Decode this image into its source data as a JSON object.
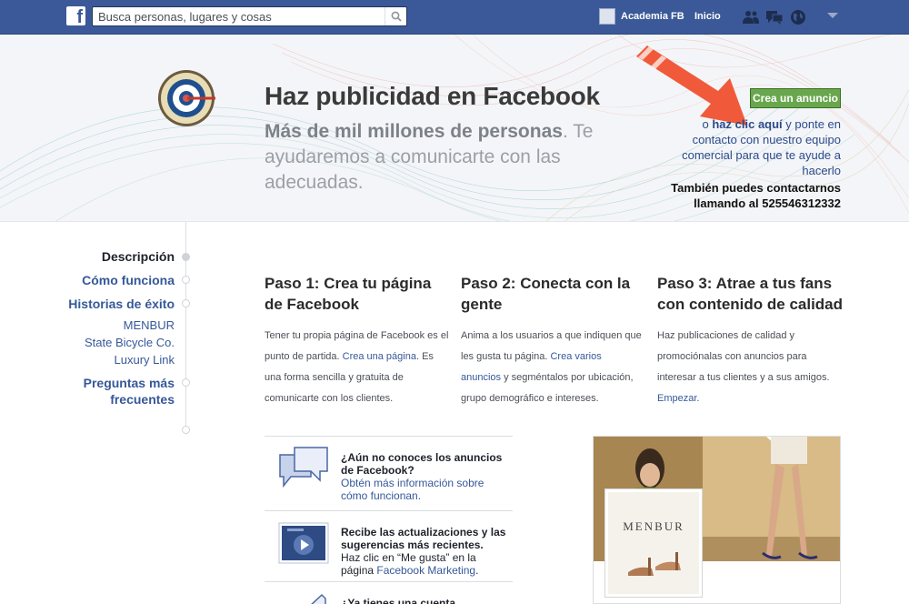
{
  "topbar": {
    "search_placeholder": "Busca personas, lugares y cosas",
    "profile_name": "Academia FB",
    "home_label": "Inicio",
    "icons": [
      "friend-requests-icon",
      "messages-icon",
      "notifications-globe-icon",
      "account-menu-caret-icon"
    ]
  },
  "hero": {
    "title": "Haz publicidad en Facebook",
    "subtitle_bold": "Más de mil millones de personas",
    "subtitle_rest": ". Te ayudaremos a comunicarte con las adecuadas.",
    "cta_button": "Crea un anuncio",
    "cta_prefix": "o ",
    "cta_link": "haz clic aquí",
    "cta_suffix": " y ponte en contacto con nuestro equipo comercial para que te ayude a hacerlo",
    "phone_text": "También puedes contactarnos llamando al 525546312332"
  },
  "sidebar": {
    "items": [
      {
        "label": "Descripción"
      },
      {
        "label": "Cómo funciona"
      },
      {
        "label": "Historias de éxito"
      }
    ],
    "success_stories": [
      "MENBUR",
      "State Bicycle Co.",
      "Luxury Link"
    ],
    "faq_line1": "Preguntas más",
    "faq_line2": "frecuentes"
  },
  "steps": [
    {
      "title": "Paso 1: Crea tu página de Facebook",
      "body_pre": "Tener tu propia página de Facebook es el punto de partida. ",
      "link": "Crea una página",
      "body_post": ". Es una forma sencilla y gratuita de comunicarte con los clientes."
    },
    {
      "title": "Paso 2: Conecta con la gente",
      "body_pre": "Anima a los usuarios a que indiquen que les gusta tu página. ",
      "link": "Crea varios anuncios",
      "body_post": " y segméntalos por ubicación, grupo demográfico e intereses."
    },
    {
      "title": "Paso 3: Atrae a tus fans con contenido de calidad",
      "body_pre": "Haz publicaciones de calidad y promociónalas con anuncios para interesar a tus clientes y a sus amigos. ",
      "link": "Empezar",
      "body_post": "."
    }
  ],
  "info_rows": [
    {
      "heading": "¿Aún no conoces los anuncios de Facebook?",
      "link": "Obtén más información sobre cómo funcionan."
    },
    {
      "heading": "Recibe las actualizaciones y las sugerencias más recientes.",
      "body": "Haz clic en “Me gusta” en la página ",
      "link": "Facebook Marketing",
      "link_suffix": "."
    },
    {
      "heading": "¿Ya tienes una cuenta"
    }
  ],
  "ad_preview": {
    "brand": "MENBUR"
  },
  "colors": {
    "facebook_blue": "#3b5998",
    "link_blue": "#365899",
    "cta_green": "#69a74e",
    "arrow_red": "#f05a3a"
  }
}
